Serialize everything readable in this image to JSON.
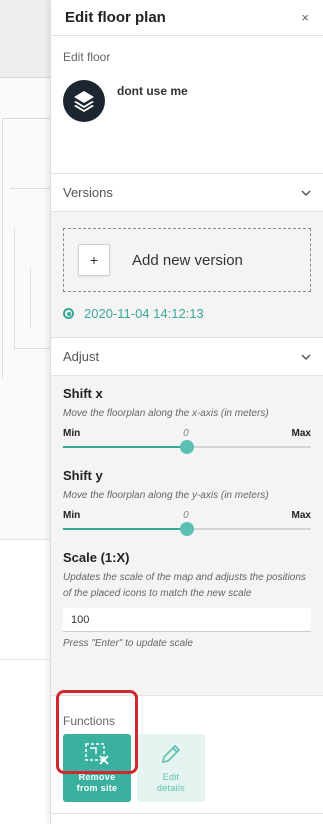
{
  "panel": {
    "title": "Edit floor plan",
    "close_label": "×"
  },
  "edit_floor": {
    "label": "Edit floor",
    "floor_name": "dont use me"
  },
  "versions": {
    "title": "Versions",
    "add_button_symbol": "+",
    "add_label": "Add new version",
    "items": [
      {
        "label": "2020-11-04 14:12:13",
        "selected": true
      }
    ]
  },
  "adjust": {
    "title": "Adjust",
    "shift_x": {
      "title": "Shift x",
      "description": "Move the floorplan along the x-axis (in meters)",
      "min_label": "Min",
      "max_label": "Max",
      "value": "0",
      "position_fraction": 0.5
    },
    "shift_y": {
      "title": "Shift y",
      "description": "Move the floorplan along the y-axis (in meters)",
      "min_label": "Min",
      "max_label": "Max",
      "value": "0",
      "position_fraction": 0.5
    },
    "scale": {
      "title": "Scale (1:X)",
      "description": "Updates the scale of the map and adjusts the positions of the placed icons to match the new scale",
      "value": "100",
      "hint": "Press \"Enter\" to update scale"
    }
  },
  "functions": {
    "title": "Functions",
    "remove": {
      "line1": "Remove",
      "line2": "from site",
      "icon": "floorplan-remove-icon"
    },
    "edit": {
      "line1": "Edit",
      "line2": "details",
      "icon": "pencil-icon"
    }
  },
  "colors": {
    "accent": "#3aa99a",
    "highlight_outline": "#d22630",
    "floor_icon_bg": "#1c2530"
  }
}
